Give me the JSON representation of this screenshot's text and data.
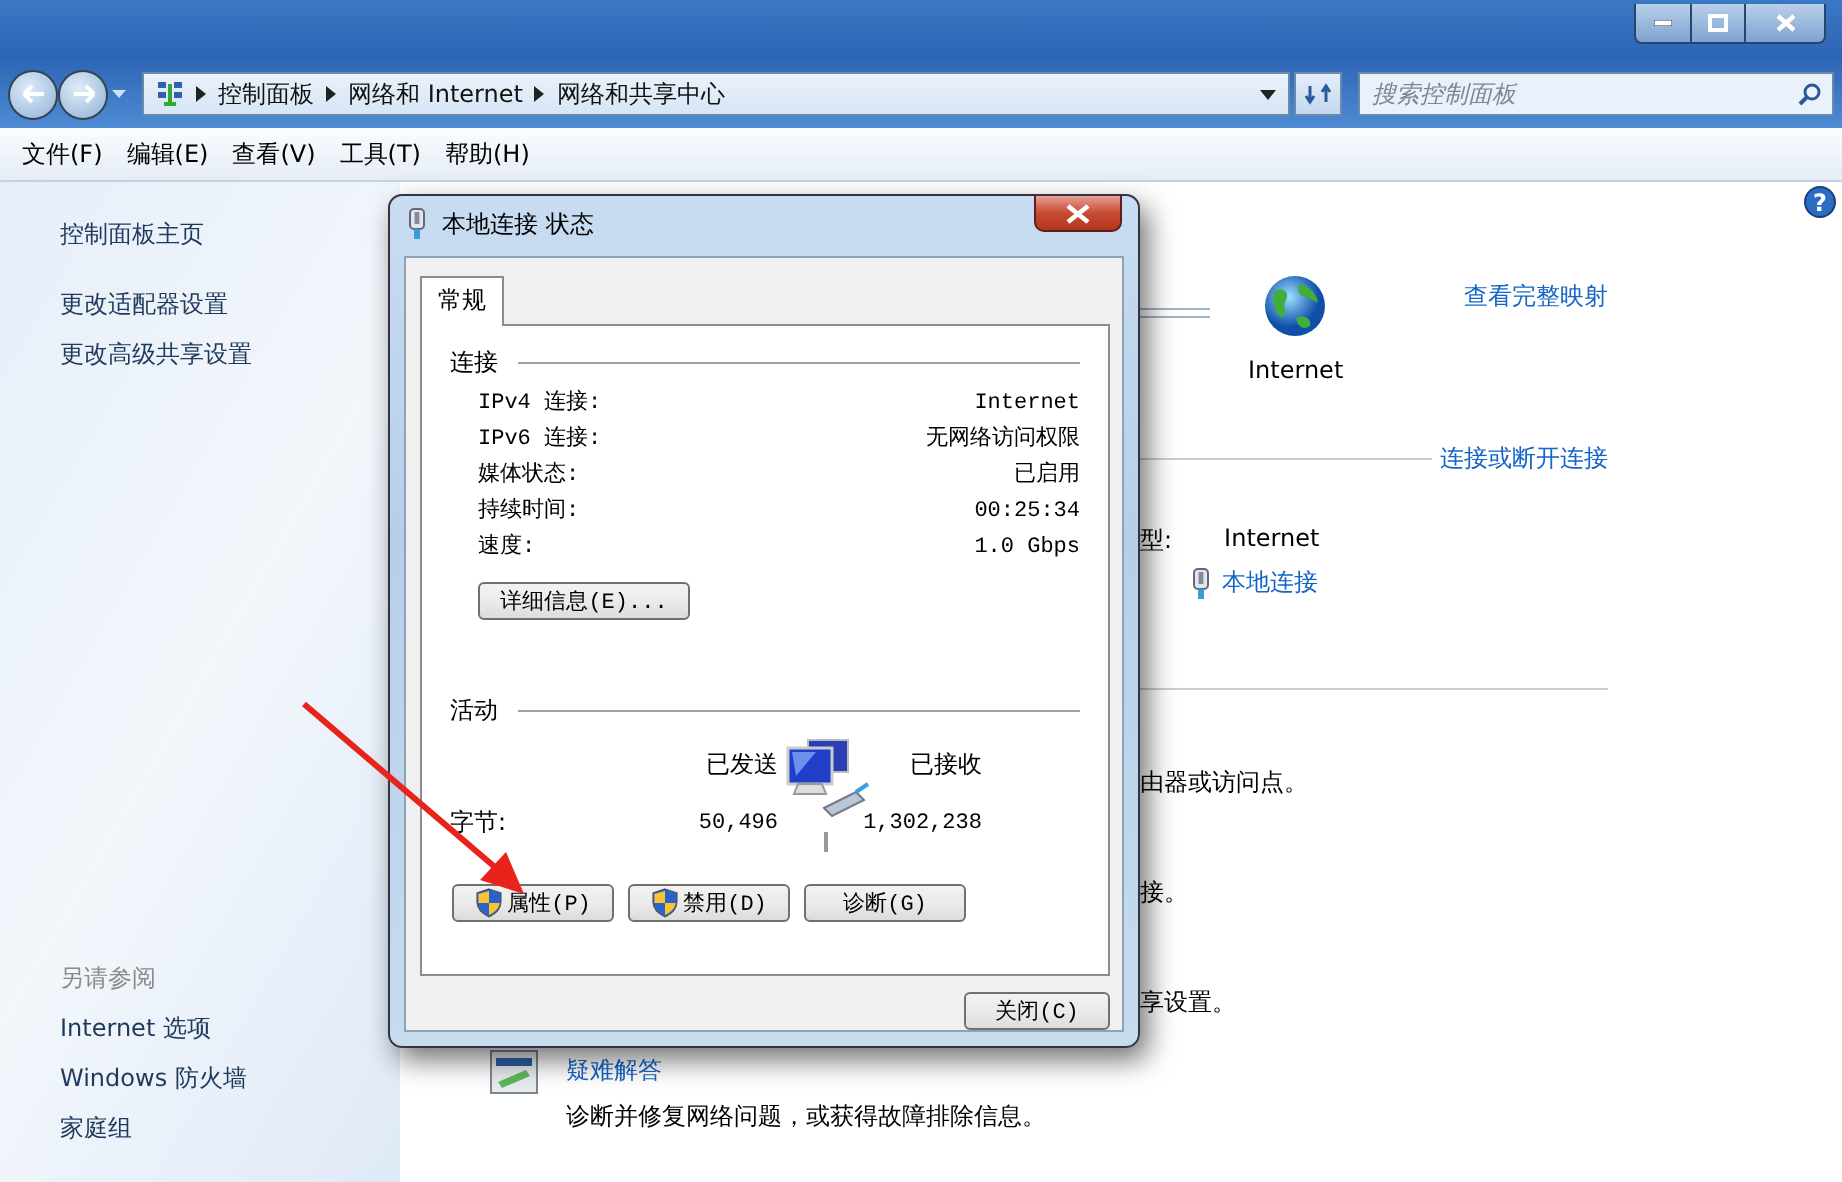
{
  "address_bar": {
    "breadcrumbs": [
      "控制面板",
      "网络和 Internet",
      "网络和共享中心"
    ],
    "search_placeholder": "搜索控制面板"
  },
  "menu": [
    "文件(F)",
    "编辑(E)",
    "查看(V)",
    "工具(T)",
    "帮助(H)"
  ],
  "help_glyph": "?",
  "sidebar": {
    "items": [
      "控制面板主页",
      "更改适配器设置",
      "更改高级共享设置"
    ],
    "see_also_heading": "另请参阅",
    "see_also": [
      "Internet 选项",
      "Windows 防火墙",
      "家庭组"
    ]
  },
  "main": {
    "map_link": "查看完整映射",
    "internet_label": "Internet",
    "connect_link": "连接或断开连接",
    "type_label": "型:",
    "type_value": "Internet",
    "connection_link": "本地连接",
    "fragments": [
      "由器或访问点。",
      "接。",
      "享设置。"
    ],
    "troubleshoot": {
      "title": "疑难解答",
      "description": "诊断并修复网络问题，或获得故障排除信息。"
    }
  },
  "dialog": {
    "title": "本地连接 状态",
    "tabs": [
      {
        "label": "常规",
        "selected": true
      }
    ],
    "connection": {
      "heading": "连接",
      "rows": [
        {
          "label": "IPv4 连接:",
          "value": "Internet"
        },
        {
          "label": "IPv6 连接:",
          "value": "无网络访问权限"
        },
        {
          "label": "媒体状态:",
          "value": "已启用"
        },
        {
          "label": "持续时间:",
          "value": "00:25:34"
        },
        {
          "label": "速度:",
          "value": "1.0 Gbps"
        }
      ],
      "details_button": "详细信息(E)..."
    },
    "activity": {
      "heading": "活动",
      "sent_label": "已发送",
      "received_label": "已接收",
      "bytes_label": "字节:",
      "sent_value": "50,496",
      "received_value": "1,302,238"
    },
    "buttons": [
      {
        "label": "属性(P)",
        "kind": "shield"
      },
      {
        "label": "禁用(D)",
        "kind": "shield"
      },
      {
        "label": "诊断(G)",
        "kind": "plain"
      }
    ],
    "close_button": "关闭(C)"
  }
}
